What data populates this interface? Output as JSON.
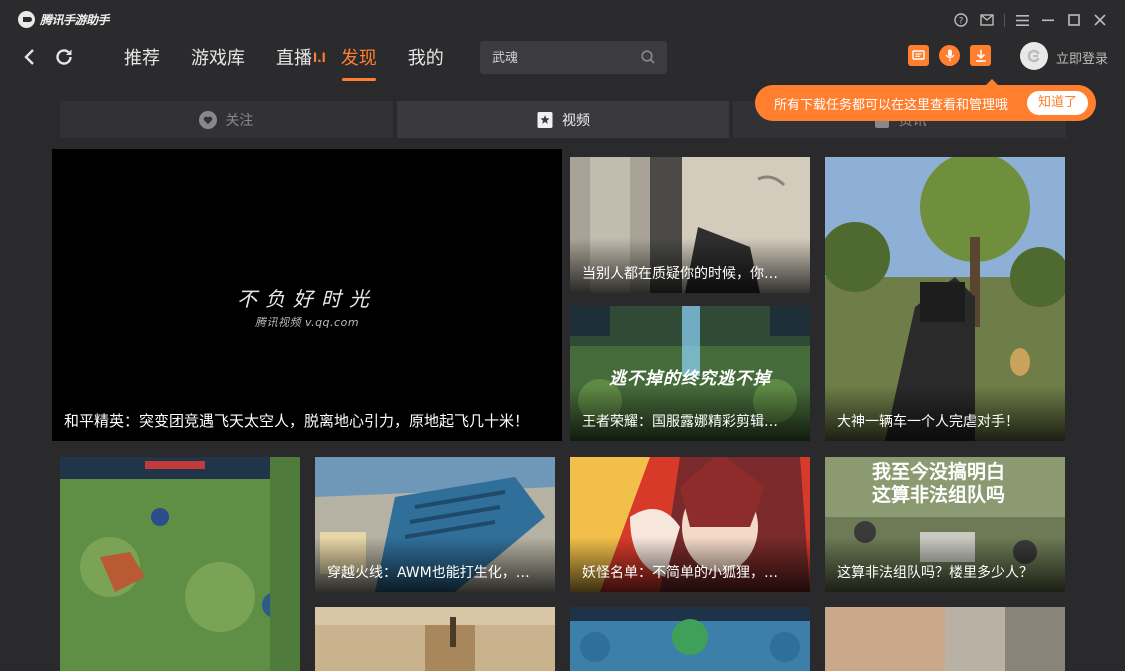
{
  "app": {
    "name": "腾讯手游助手"
  },
  "window_controls": [
    "help-icon",
    "mail-icon",
    "menu-icon",
    "minimize-icon",
    "maximize-icon",
    "close-icon"
  ],
  "nav": {
    "tabs": [
      {
        "label": "推荐"
      },
      {
        "label": "游戏库"
      },
      {
        "label": "直播",
        "badge": "l.l"
      },
      {
        "label": "发现",
        "active": true
      },
      {
        "label": "我的"
      }
    ]
  },
  "search": {
    "value": "武魂"
  },
  "user": {
    "login_label": "立即登录"
  },
  "tooltip": {
    "text": "所有下载任务都可以在这里查看和管理哦",
    "button": "知道了"
  },
  "subtabs": [
    {
      "label": "关注"
    },
    {
      "label": "视频",
      "active": true
    },
    {
      "label": "资讯"
    }
  ],
  "featured": {
    "slogan": "不负好时光",
    "source": "腾讯视频 v.qq.com",
    "title": "和平精英：突变团竞遇飞天太空人，脱离地心引力，原地起飞几十米！"
  },
  "videos": [
    {
      "title": "当别人都在质疑你的时候，你…"
    },
    {
      "title": "大神一辆车一个人完虐对手！"
    },
    {
      "title": "王者荣耀：国服露娜精彩剪辑…",
      "overlay": "逃不掉的终究逃不掉"
    },
    {
      "title": "穿越火线：AWM也能打生化，…"
    },
    {
      "title": "妖怪名单：不简单的小狐狸，…"
    },
    {
      "title": "这算非法组队吗？楼里多少人？",
      "overlay_lines": [
        "我至今没搞明白",
        "这算非法组队吗"
      ]
    },
    {
      "title": ""
    },
    {
      "title": ""
    },
    {
      "title": ""
    },
    {
      "title": ""
    }
  ],
  "colors": {
    "accent": "#ff7f2e",
    "background": "#2a2a2d"
  }
}
